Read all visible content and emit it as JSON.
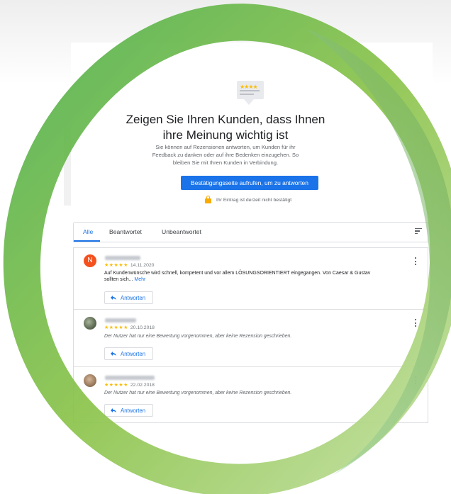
{
  "hero": {
    "title_line1": "Zeigen Sie Ihren Kunden, dass Ihnen",
    "title_line2": "ihre Meinung wichtig ist",
    "desc_line1": "Sie können auf Rezensionen antworten, um Kunden für ihr",
    "desc_line2": "Feedback zu danken oder auf ihre Bedenken einzugehen. So",
    "desc_line3": "bleiben Sie mit Ihren Kunden in Verbindung.",
    "cta_label": "Bestätigungsseite aufrufen, um zu antworten",
    "lock_note": "Ihr Eintrag ist derzeit nicht bestätigt",
    "badge_stars": "★★★★"
  },
  "tabs": {
    "all": "Alle",
    "answered": "Beantwortet",
    "unanswered": "Unbeantwortet"
  },
  "colors": {
    "accent": "#1a73e8",
    "star": "#fbbc04",
    "ring_green": "#8bc34a"
  },
  "reviews": [
    {
      "avatar_letter": "N",
      "stars": "★★★★★",
      "date": "14.11.2020",
      "text_line1": "Auf Kundenwünsche wird schnell, kompetent und vor allem LÖSUNGSORIENTIERT eingegangen. Von Caesar & Gustav",
      "text_line2": "sollten sich...",
      "more": "Mehr",
      "reply_label": "Antworten"
    },
    {
      "stars": "★★★★★",
      "date": "20.10.2018",
      "text": "Der Nutzer hat nur eine Bewertung vorgenommen, aber keine Rezension geschrieben.",
      "reply_label": "Antworten"
    },
    {
      "stars": "★★★★★",
      "date": "22.02.2018",
      "text": "Der Nutzer hat nur eine Bewertung vorgenommen, aber keine Rezension geschrieben.",
      "reply_label": "Antworten"
    }
  ]
}
